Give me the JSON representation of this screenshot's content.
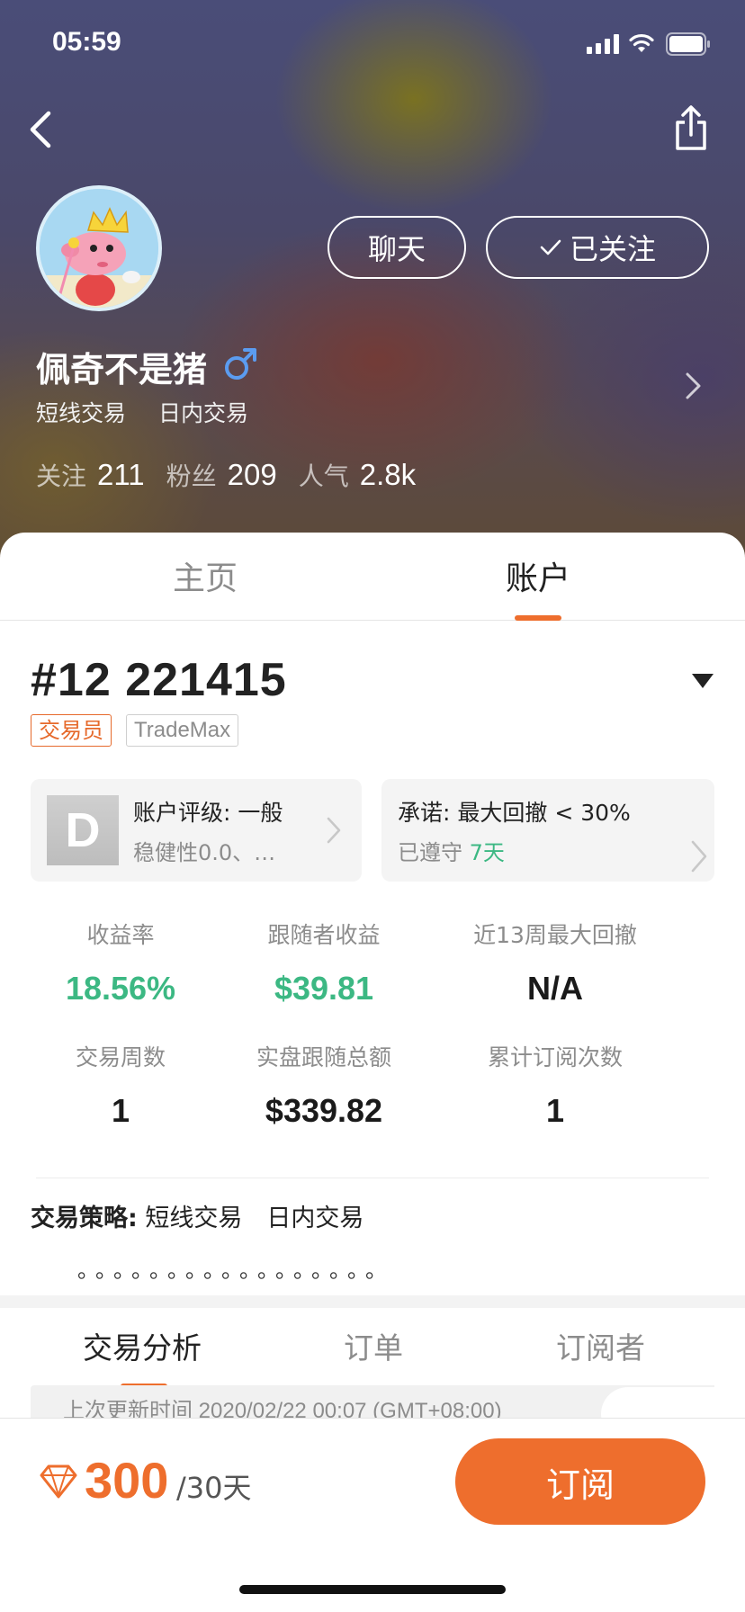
{
  "status_bar": {
    "time": "05:59"
  },
  "profile": {
    "name": "佩奇不是猪",
    "gender_symbol": "♂",
    "tags": [
      "短线交易",
      "日内交易"
    ],
    "stats": [
      {
        "label": "关注",
        "value": "211"
      },
      {
        "label": "粉丝",
        "value": "209"
      },
      {
        "label": "人气",
        "value": "2.8k"
      }
    ],
    "chat_label": "聊天",
    "follow_label": "已关注"
  },
  "tabs": {
    "home": "主页",
    "account": "账户",
    "active": "账户"
  },
  "account": {
    "number": "#12 221415",
    "badge_role": "交易员",
    "badge_platform": "TradeMax",
    "rating": {
      "grade": "D",
      "title": "账户评级: 一般",
      "subtitle": "稳健性0.0、…"
    },
    "promise": {
      "title": "承诺: 最大回撤 < 30%",
      "subtitle_prefix": "已遵守",
      "days": "7天"
    },
    "metrics": [
      {
        "label": "收益率",
        "value": "18.56%",
        "tone": "green"
      },
      {
        "label": "跟随者收益",
        "value": "$39.81",
        "tone": "green"
      },
      {
        "label": "近13周最大回撤",
        "value": "N/A",
        "tone": "dark"
      },
      {
        "label": "交易周数",
        "value": "1",
        "tone": "dark"
      },
      {
        "label": "实盘跟随总额",
        "value": "$339.82",
        "tone": "dark"
      },
      {
        "label": "累计订阅次数",
        "value": "1",
        "tone": "dark"
      }
    ],
    "strategy_label": "交易策略:",
    "strategy_text": "短线交易　日内交易",
    "strategy_dots": "。。。。。。。。。。。。。。。。。"
  },
  "analysis_tabs": {
    "analysis": "交易分析",
    "orders": "订单",
    "subscribers": "订阅者",
    "active": "交易分析"
  },
  "update_time": "上次更新时间 2020/02/22 00:07 (GMT+08:00)",
  "footer": {
    "price": "300",
    "period": "/30天",
    "subscribe_label": "订阅"
  },
  "colors": {
    "accent": "#ee6e2d",
    "positive": "#3cb883",
    "gender": "#5b9cf0"
  },
  "icons": [
    "back-icon",
    "share-icon",
    "checkmark-icon",
    "male-icon",
    "chevron-right-icon",
    "dropdown-triangle-icon",
    "diamond-icon",
    "signal-icon",
    "wifi-icon",
    "battery-icon"
  ]
}
